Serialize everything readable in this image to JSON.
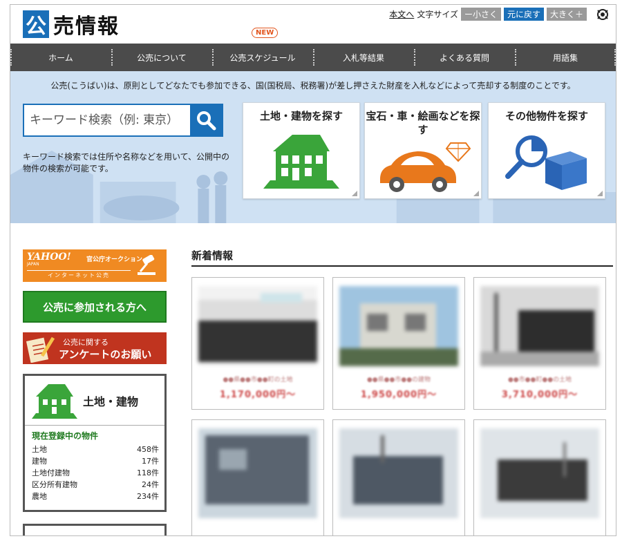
{
  "header": {
    "logo_char": "公",
    "logo_text": "売情報",
    "skip_link": "本文へ",
    "font_size_label": "文字サイズ",
    "font_small": "ー小さく",
    "font_reset": "元に戻す",
    "font_large": "大きく＋"
  },
  "nav": {
    "new_badge": "NEW",
    "items": [
      "ホーム",
      "公売について",
      "公売スケジュール",
      "入札等結果",
      "よくある質問",
      "用語集"
    ]
  },
  "hero": {
    "description": "公売(こうばい)は、原則としてどなたでも参加できる、国(国税局、税務署)が差し押さえた財産を入札などによって売却する制度のことです。",
    "search_placeholder": "キーワード検索（例: 東京）",
    "search_note": "キーワード検索では住所や名称などを用いて、公開中の物件の検索が可能です。",
    "categories": [
      {
        "label": "土地・建物を探す",
        "icon": "house-icon",
        "color": "#3aa53a"
      },
      {
        "label": "宝石・車・絵画などを探す",
        "icon": "car-gem-icon",
        "color": "#e8781c"
      },
      {
        "label": "その他物件を探す",
        "icon": "magnifier-box-icon",
        "color": "#2a64b5"
      }
    ]
  },
  "sidebar": {
    "yahoo_logo": "YAHOO!",
    "yahoo_sub": "JAPAN",
    "yahoo_tag": "官公庁オークション",
    "yahoo_banner": "インターネット公売",
    "participate": "公売に参加される方へ",
    "survey_small": "公売に関する",
    "survey_large": "アンケートのお願い",
    "land_title": "土地・建物",
    "current_label": "現在登録中の物件",
    "stats": [
      {
        "name": "土地",
        "count": "458件"
      },
      {
        "name": "建物",
        "count": "17件"
      },
      {
        "name": "土地付建物",
        "count": "118件"
      },
      {
        "name": "区分所有建物",
        "count": "24件"
      },
      {
        "name": "農地",
        "count": "234件"
      }
    ]
  },
  "news": {
    "title": "新着情報",
    "cards": [
      {
        "caption": "●●県●●市●●町の土地",
        "price": "1,170,000円～"
      },
      {
        "caption": "●●県●●市●●の建物",
        "price": "1,950,000円～"
      },
      {
        "caption": "●●市●●町●●の土地",
        "price": "3,710,000円～"
      },
      {
        "caption": "",
        "price": ""
      },
      {
        "caption": "",
        "price": ""
      },
      {
        "caption": "",
        "price": ""
      }
    ]
  },
  "colors": {
    "accent": "#1a6fb8",
    "nav_bg": "#4b4b4b",
    "hero_bg": "#cfe1f3",
    "green": "#2d9a2d",
    "orange": "#f08a22",
    "red": "#c0341f"
  }
}
